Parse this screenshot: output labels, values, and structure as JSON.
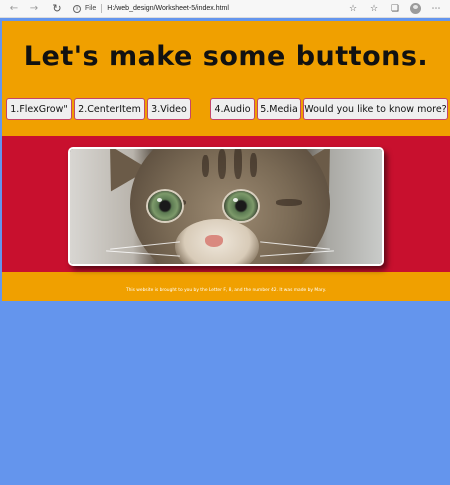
{
  "browser": {
    "file_label": "File",
    "url": "H:/web_design/Worksheet-5/index.html"
  },
  "page": {
    "headline": "Let's make some buttons.",
    "buttons": [
      "1.FlexGrow\"",
      "2.CenterItem",
      "3.Video",
      "4.Audio",
      "5.Media",
      "Would you like to know more?"
    ],
    "image_alt": "kitten",
    "footer": "This website is brought to you by the Letter F, 8, and the number 42. It was made by Mary."
  },
  "colors": {
    "page_bg": "#6495ed",
    "header_bg": "#f0a000",
    "band_bg": "#c8102e",
    "button_bg": "#efefef",
    "button_border": "#c4466a"
  },
  "icons": [
    "back-arrow-icon",
    "forward-arrow-icon",
    "reload-icon",
    "info-icon",
    "favorite-star-icon",
    "collections-icon",
    "extensions-icon",
    "profile-avatar",
    "more-options-icon",
    "read-aloud-icon"
  ]
}
